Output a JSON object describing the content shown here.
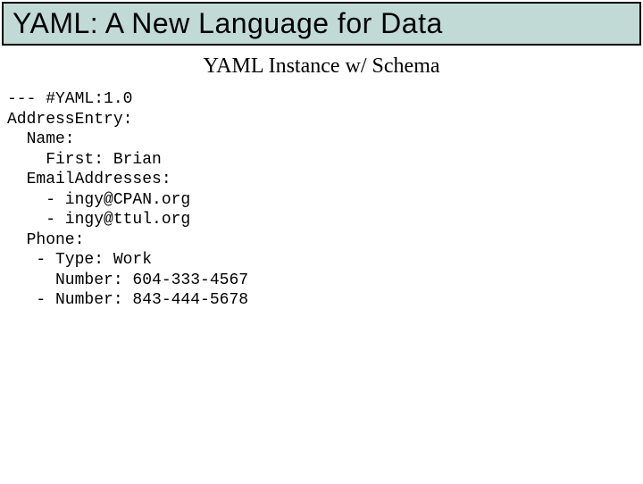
{
  "header": {
    "title": "YAML: A New Language for Data"
  },
  "subtitle": "YAML Instance w/ Schema",
  "code": "--- #YAML:1.0\nAddressEntry:\n  Name:\n    First: Brian\n  EmailAddresses:\n    - ingy@CPAN.org\n    - ingy@ttul.org\n  Phone:\n   - Type: Work\n     Number: 604-333-4567\n   - Number: 843-444-5678"
}
